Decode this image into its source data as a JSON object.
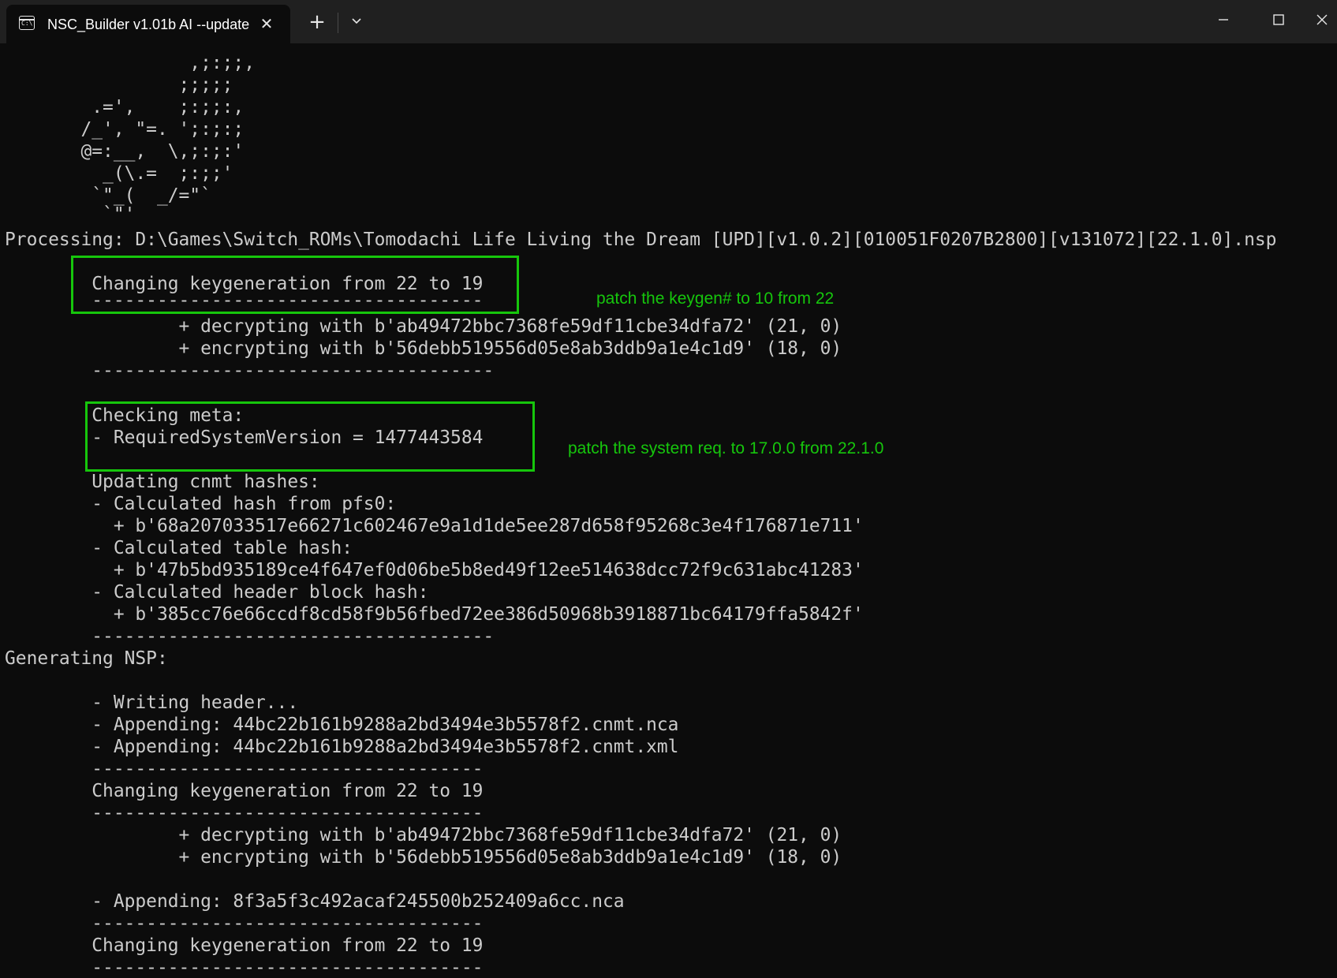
{
  "window": {
    "tab_title": "NSC_Builder v1.01b AI --update",
    "tab_icon": "terminal-icon",
    "close_tab_icon": "close-icon",
    "new_tab_icon": "plus-icon",
    "dropdown_icon": "chevron-down-icon",
    "minimize_icon": "minimize-icon",
    "maximize_icon": "maximize-icon",
    "close_window_icon": "close-icon"
  },
  "colors": {
    "background": "#0c0c0c",
    "titlebar": "#202020",
    "text": "#cccccc",
    "annotation": "#16c60c"
  },
  "terminal": {
    "lines": [
      "                 ,;:;;,",
      "                ;;;;;",
      "        .=',    ;:;;:,",
      "       /_', \"=. ';:;:;",
      "       @=:__,  \\,;:;:'",
      "         _(\\.=  ;:;;'",
      "        `\"_(  _/=\"`",
      "         `\"'",
      "Processing: D:\\Games\\Switch_ROMs\\Tomodachi Life Living the Dream [UPD][v1.0.2][010051F0207B2800][v131072][22.1.0].nsp",
      "        ------------------------------------",
      "        Changing keygeneration from 22 to 19",
      "        ------------------------------------",
      "                + decrypting with b'ab49472bbc7368fe59df11cbe34dfa72' (21, 0)",
      "                + encrypting with b'56debb519556d05e8ab3ddb9a1e4c1d9' (18, 0)",
      "        -------------------------------------",
      "",
      "        Checking meta:",
      "        - RequiredSystemVersion = 1477443584",
      "",
      "        Updating cnmt hashes:",
      "        - Calculated hash from pfs0:",
      "          + b'68a207033517e66271c602467e9a1d1de5ee287d658f95268c3e4f176871e711'",
      "        - Calculated table hash:",
      "          + b'47b5bd935189ce4f647ef0d06be5b8ed49f12ee514638dcc72f9c631abc41283'",
      "        - Calculated header block hash:",
      "          + b'385cc76e66ccdf8cd58f9b56fbed72ee386d50968b3918871bc64179ffa5842f'",
      "        -------------------------------------",
      "Generating NSP:",
      "",
      "        - Writing header...",
      "        - Appending: 44bc22b161b9288a2bd3494e3b5578f2.cnmt.nca",
      "        - Appending: 44bc22b161b9288a2bd3494e3b5578f2.cnmt.xml",
      "        ------------------------------------",
      "        Changing keygeneration from 22 to 19",
      "        ------------------------------------",
      "                + decrypting with b'ab49472bbc7368fe59df11cbe34dfa72' (21, 0)",
      "                + encrypting with b'56debb519556d05e8ab3ddb9a1e4c1d9' (18, 0)",
      "",
      "        - Appending: 8f3a5f3c492acaf245500b252409a6cc.nca",
      "        ------------------------------------",
      "        Changing keygeneration from 22 to 19",
      "        ------------------------------------"
    ]
  },
  "annotations": {
    "keygen_note": "patch the keygen# to 10 from 22",
    "sysreq_note": "patch the system req. to 17.0.0 from 22.1.0"
  }
}
